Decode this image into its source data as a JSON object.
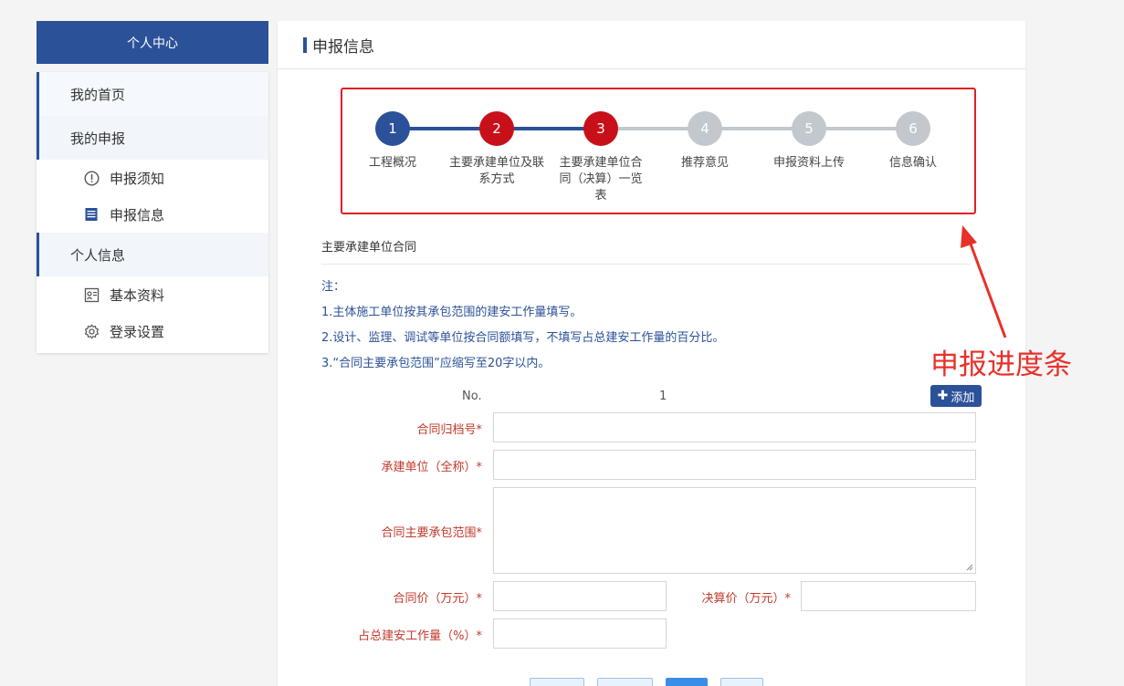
{
  "sidebar": {
    "header": "个人中心",
    "groups": [
      {
        "label": "我的首页"
      },
      {
        "label": "我的申报",
        "items": [
          {
            "label": "申报须知",
            "icon": "exclamation-circle-icon"
          },
          {
            "label": "申报信息",
            "icon": "list-doc-icon"
          }
        ]
      },
      {
        "label": "个人信息",
        "items": [
          {
            "label": "基本资料",
            "icon": "id-card-icon"
          },
          {
            "label": "登录设置",
            "icon": "gear-icon"
          }
        ]
      }
    ]
  },
  "main": {
    "title": "申报信息",
    "steps": [
      {
        "num": "1",
        "label": "工程概况",
        "state": "done"
      },
      {
        "num": "2",
        "label": "主要承建单位及联系方式",
        "state": "active"
      },
      {
        "num": "3",
        "label": "主要承建单位合同（决算）一览表",
        "state": "active"
      },
      {
        "num": "4",
        "label": "推荐意见",
        "state": "todo"
      },
      {
        "num": "5",
        "label": "申报资料上传",
        "state": "todo"
      },
      {
        "num": "6",
        "label": "信息确认",
        "state": "todo"
      }
    ],
    "section_title": "主要承建单位合同",
    "notes": [
      "注：",
      "1.主体施工单位按其承包范围的建安工作量填写。",
      "2.设计、监理、调试等单位按合同额填写，不填写占总建安工作量的百分比。",
      "3.“合同主要承包范围”应缩写至20字以内。"
    ],
    "form": {
      "no_label": "No.",
      "no_value": "1",
      "add_button": "添加",
      "fields": {
        "archive_no": "合同归档号*",
        "contractor": "承建单位（全称）*",
        "scope": "合同主要承包范围*",
        "price": "合同价（万元）*",
        "final_price": "决算价（万元）*",
        "percent": "占总建安工作量（%）*"
      }
    }
  },
  "annotation": {
    "text": "申报进度条",
    "color": "#e8302a"
  },
  "colors": {
    "primary": "#2b5199",
    "active_step": "#c8101a",
    "todo_step": "#c3c8ce"
  }
}
